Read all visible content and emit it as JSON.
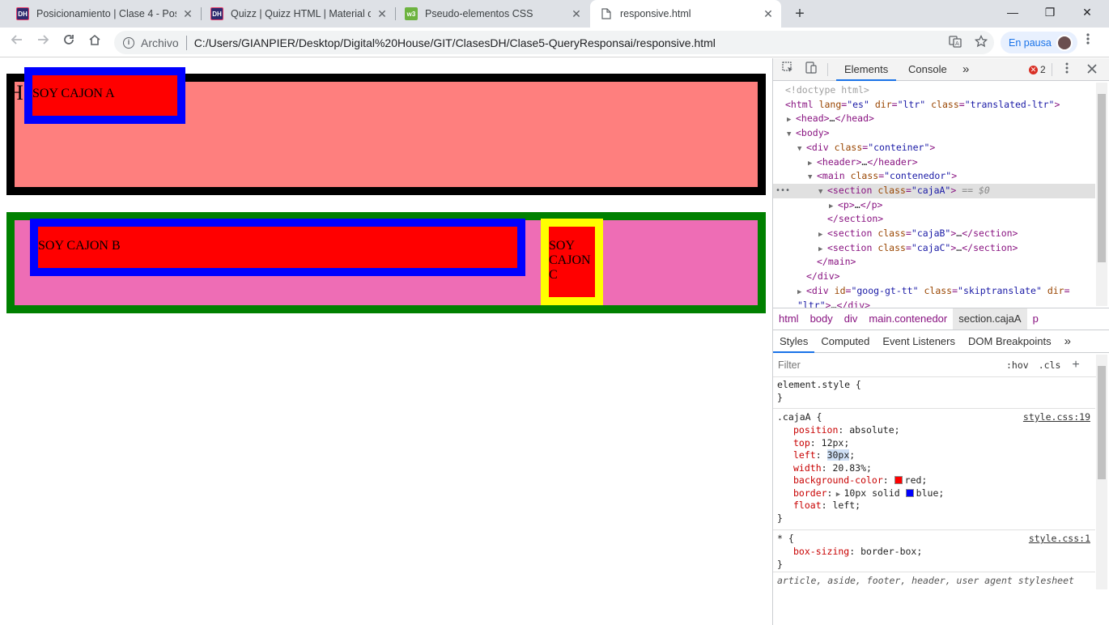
{
  "browser": {
    "tabs": [
      {
        "title": "Posicionamiento | Clase 4 - Posic",
        "favicon": "DH",
        "active": false
      },
      {
        "title": "Quizz | Quizz HTML | Material del",
        "favicon": "DH",
        "active": false
      },
      {
        "title": "Pseudo-elementos CSS",
        "favicon": "w3",
        "active": false
      },
      {
        "title": "responsive.html",
        "favicon": "file-icon",
        "active": true
      }
    ],
    "close_glyph": "✕",
    "new_tab_glyph": "+",
    "window_controls": {
      "minimize": "—",
      "restore": "❐",
      "close": "✕"
    },
    "address": {
      "scheme_label": "Archivo",
      "url": "C:/Users/GIANPIER/Desktop/Digital%20House/GIT/ClasesDH/Clase5-QueryResponsai/responsive.html"
    },
    "profile_label": "En pausa"
  },
  "page": {
    "header_letter": "H",
    "cajaA_text": "SOY CAJON A",
    "cajaB_text": "SOY CAJON B",
    "cajaC_text": "SOY CAJON C"
  },
  "devtools": {
    "tabs": [
      "Elements",
      "Console"
    ],
    "more_tabs_glyph": "»",
    "error_count": "2",
    "dom": {
      "doctype": "<!doctype html>",
      "selected_marker": "== $0"
    },
    "breadcrumbs": [
      "html",
      "body",
      "div",
      "main.contenedor",
      "section.cajaA",
      "p"
    ],
    "style_tabs": [
      "Styles",
      "Computed",
      "Event Listeners",
      "DOM Breakpoints"
    ],
    "filter_placeholder": "Filter",
    "filter_buttons": {
      "hov": ":hov",
      "cls": ".cls",
      "add": "+"
    },
    "styles": {
      "element_style_selector": "element.style {",
      "close_brace": "}",
      "rule1": {
        "selector": ".cajaA {",
        "source": "style.css:19",
        "decls": [
          {
            "prop": "position",
            "value": "absolute;"
          },
          {
            "prop": "top",
            "value": "12px;"
          },
          {
            "prop": "left",
            "value": "30px",
            "suffix": ";"
          },
          {
            "prop": "width",
            "value": "20.83%;"
          },
          {
            "prop": "background-color",
            "value": "red;",
            "swatch": "#ff0000"
          },
          {
            "prop": "border",
            "value": "10px solid",
            "value2": "blue;",
            "swatch": "#0000ff"
          },
          {
            "prop": "float",
            "value": "left;"
          }
        ]
      },
      "rule2": {
        "selector": "* {",
        "source": "style.css:1",
        "decls": [
          {
            "prop": "box-sizing",
            "value": "border-box;"
          }
        ]
      },
      "ua_line": "article, aside, footer, header, user agent stylesheet"
    }
  },
  "colors": {
    "header_bg": "#fe7f7e",
    "main_bg": "#ee6db5",
    "box_red": "#ff0000",
    "border_blue": "#0000ff",
    "border_green": "#008000",
    "border_yellow": "#ffff00",
    "accent": "#1a73e8"
  }
}
